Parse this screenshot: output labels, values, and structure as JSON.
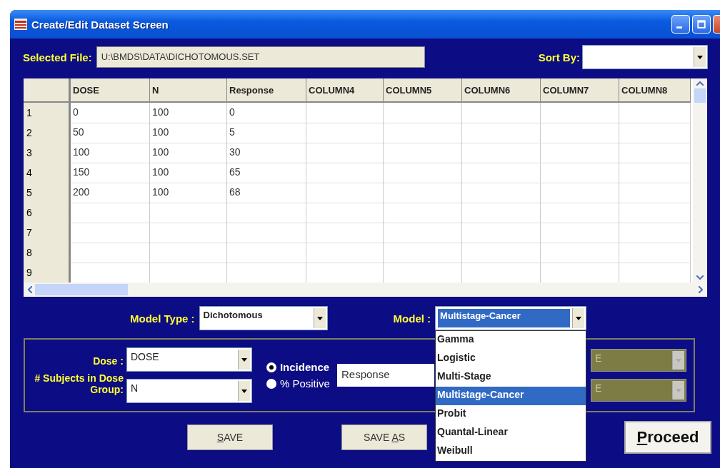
{
  "window": {
    "title": "Create/Edit Dataset Screen"
  },
  "selected_file": {
    "label": "Selected File:",
    "value": "U:\\BMDS\\DATA\\DICHOTOMOUS.SET"
  },
  "sort_by": {
    "label": "Sort By:"
  },
  "grid": {
    "columns": [
      "DOSE",
      "N",
      "Response",
      "COLUMN4",
      "COLUMN5",
      "COLUMN6",
      "COLUMN7",
      "COLUMN8"
    ],
    "rows": [
      {
        "number": "1",
        "cells": [
          "0",
          "100",
          "0"
        ]
      },
      {
        "number": "2",
        "cells": [
          "50",
          "100",
          "5"
        ]
      },
      {
        "number": "3",
        "cells": [
          "100",
          "100",
          "30"
        ]
      },
      {
        "number": "4",
        "cells": [
          "150",
          "100",
          "65"
        ]
      },
      {
        "number": "5",
        "cells": [
          "200",
          "100",
          "68"
        ]
      },
      {
        "number": "6",
        "cells": []
      },
      {
        "number": "7",
        "cells": []
      },
      {
        "number": "8",
        "cells": []
      },
      {
        "number": "9",
        "cells": []
      }
    ]
  },
  "model_type": {
    "label": "Model  Type :",
    "value": "Dichotomous"
  },
  "model": {
    "label": "Model :",
    "value": "Multistage-Cancer",
    "expanded": true,
    "options": [
      {
        "label": "Gamma",
        "selected": false
      },
      {
        "label": "Logistic",
        "selected": false
      },
      {
        "label": "Multi-Stage",
        "selected": false
      },
      {
        "label": "Multistage-Cancer",
        "selected": true
      },
      {
        "label": "Probit",
        "selected": false
      },
      {
        "label": "Quantal-Linear",
        "selected": false
      },
      {
        "label": "Weibull",
        "selected": false
      }
    ]
  },
  "dose": {
    "label": "Dose :",
    "value": "DOSE"
  },
  "subjects": {
    "label": "# Subjects in Dose Group:",
    "value": "N"
  },
  "response_type": [
    {
      "label": "Incidence",
      "selected": true
    },
    {
      "label": "% Positive",
      "selected": false
    }
  ],
  "response": {
    "value": "Response"
  },
  "disabled_fields": [
    {
      "value": "E",
      "disabled": true
    },
    {
      "value": "E",
      "disabled": true
    }
  ],
  "buttons": [
    {
      "access_key": "S",
      "after_key": "AVE",
      "kind": "flat"
    },
    {
      "before_key": "SAVE ",
      "access_key": "A",
      "after_key": "S",
      "kind": "flat"
    },
    {
      "access_key": "P",
      "after_key": "roceed",
      "kind": "large"
    }
  ]
}
